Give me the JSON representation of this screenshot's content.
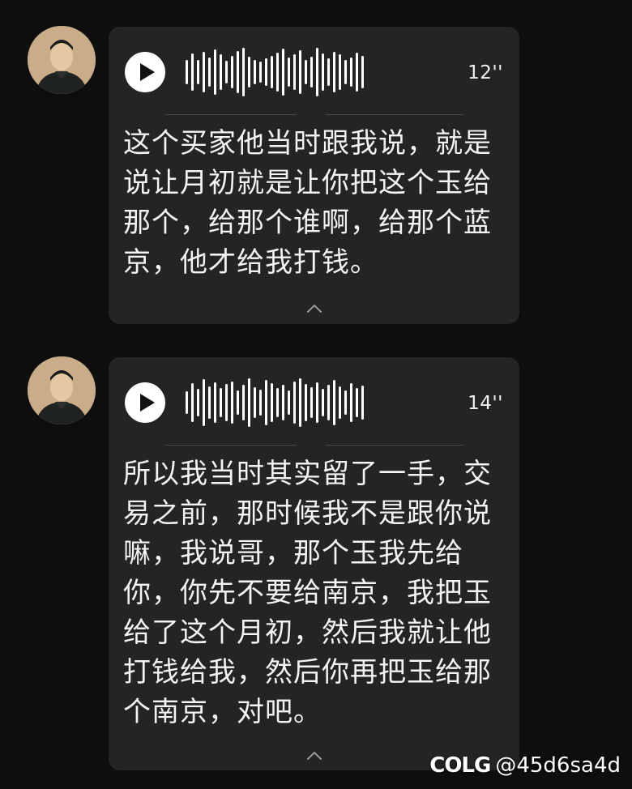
{
  "messages": [
    {
      "duration": "12''",
      "transcript": "这个买家他当时跟我说，就是说让月初就是让你把这个玉给那个，给那个谁啊，给那个蓝京，他才给我打钱。"
    },
    {
      "duration": "14''",
      "transcript": "所以我当时其实留了一手，交易之前，那时候我不是跟你说嘛，我说哥，那个玉我先给你，你先不要给南京，我把玉给了这个月初，然后我就让他打钱给我，然后你再把玉给那个南京，对吧。"
    }
  ],
  "watermark": {
    "logo": "COLG",
    "handle": "@45d6sa4d"
  },
  "icons": {
    "play": "play-icon",
    "collapse": "chevron-up-icon",
    "avatar": "user-avatar"
  },
  "colors": {
    "background": "#0e0e0f",
    "bubble": "#242426",
    "text": "#f4f4f4"
  }
}
